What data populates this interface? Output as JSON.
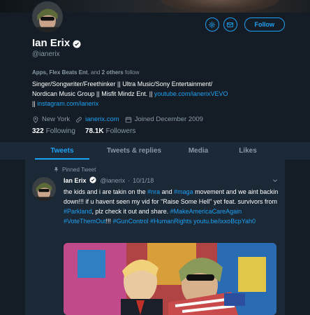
{
  "profile": {
    "name": "Ian Erix",
    "handle": "@ianerix",
    "follow_label": "Follow",
    "followed_by": {
      "prefix": "Apps, Flex Beats Ent",
      "middle": ", and ",
      "others": "2 others",
      "suffix": " follow"
    },
    "bio": {
      "line1": "Singer/Songwriter/Freethinker || Ultra Music/Sony Entertainment/",
      "line2_text": "Nordican Music Group || Misfit Mindz Ent. || ",
      "line2_link": "youtube.com/ianerixVEVO",
      "line3_prefix": "|| ",
      "line3_link": "instagram.com/ianerix"
    },
    "location": "New York",
    "website": "ianerix.com",
    "joined": "Joined December 2009",
    "following_count": "322",
    "following_label": "Following",
    "followers_count": "78.1K",
    "followers_label": "Followers"
  },
  "tabs": [
    {
      "label": "Tweets",
      "active": true
    },
    {
      "label": "Tweets & replies",
      "active": false
    },
    {
      "label": "Media",
      "active": false
    },
    {
      "label": "Likes",
      "active": false
    }
  ],
  "tweet": {
    "pinned_label": "Pinned Tweet",
    "author": "Ian Erix",
    "handle": "@ianerix",
    "separator": "·",
    "date": "10/1/18",
    "segments": [
      {
        "t": "the kids and i are takin on the ",
        "link": false
      },
      {
        "t": "#nra",
        "link": true
      },
      {
        "t": " and ",
        "link": false
      },
      {
        "t": "#maga",
        "link": true
      },
      {
        "t": " movement and we aint backin down!!! if u havent seen my vid for \"Raise Some Hell\" yet feat. survivors from ",
        "link": false
      },
      {
        "t": "#Parkland",
        "link": true
      },
      {
        "t": ", plz check it out and share. ",
        "link": false
      },
      {
        "t": "#MakeAmericaCareAgain",
        "link": true
      },
      {
        "t": " ",
        "link": false
      },
      {
        "t": "#VoteThemOut",
        "link": true
      },
      {
        "t": "!!! ",
        "link": false
      },
      {
        "t": "#GunControl",
        "link": true
      },
      {
        "t": " ",
        "link": false
      },
      {
        "t": "#HumanRights",
        "link": true
      },
      {
        "t": " ",
        "link": false
      },
      {
        "t": "youtu.be/ixxoBcpYah0",
        "link": true
      }
    ]
  },
  "icons": {
    "settings": "gear-icon",
    "message": "mail-icon",
    "verified": "verified-badge-icon",
    "location": "location-pin-icon",
    "website": "link-icon",
    "joined": "calendar-icon",
    "pin": "pin-icon",
    "caret": "chevron-down-icon"
  },
  "colors": {
    "background": "#141d26",
    "accent": "#1da1f2",
    "muted": "#8899a6",
    "tabbar": "#1c2938"
  }
}
